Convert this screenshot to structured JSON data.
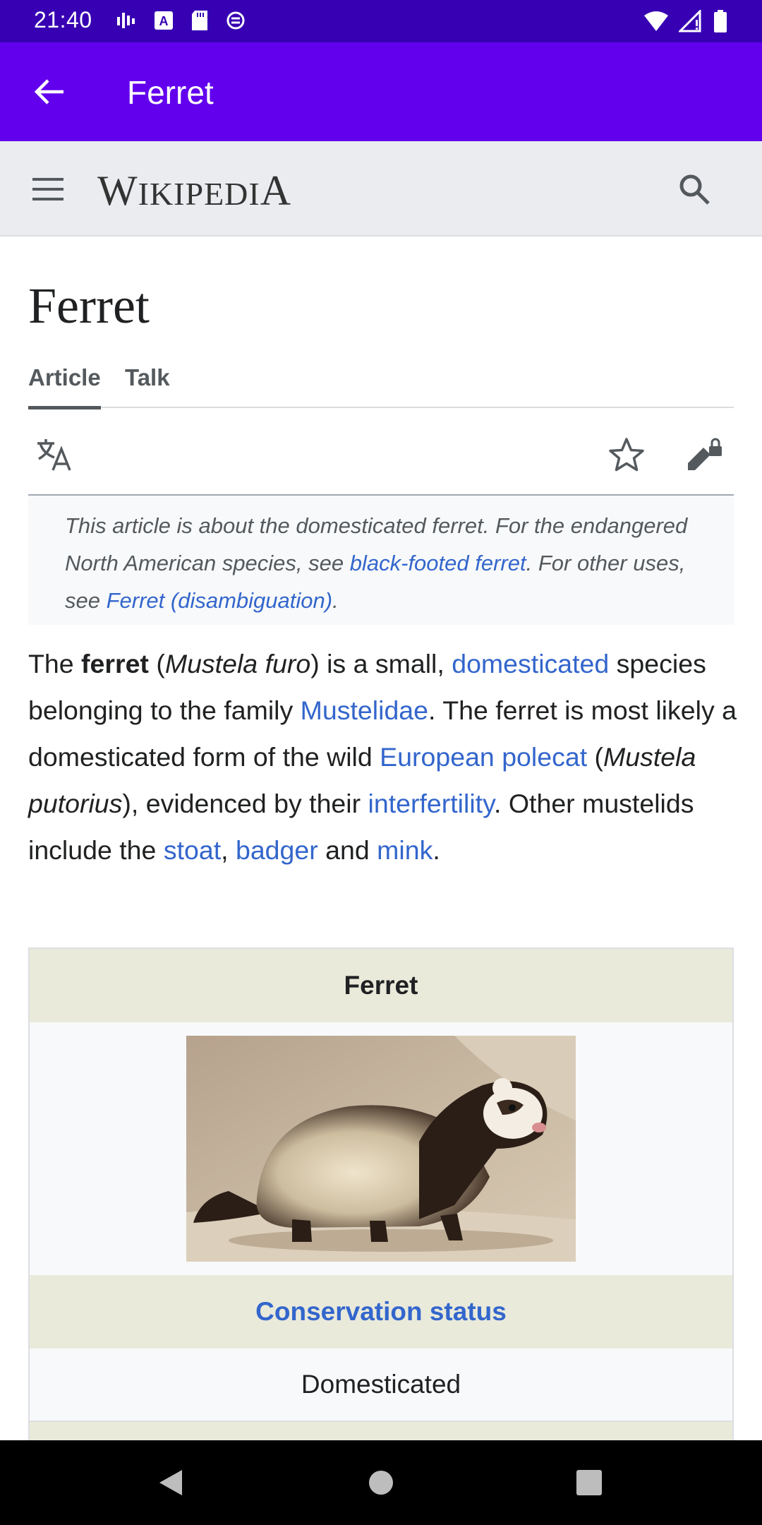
{
  "status_bar": {
    "time": "21:40"
  },
  "app_bar": {
    "title": "Ferret"
  },
  "wiki_header": {
    "wordmark_first": "W",
    "wordmark_rest": "IKIPEDI",
    "wordmark_last": "A"
  },
  "article": {
    "title": "Ferret",
    "tabs": [
      {
        "label": "Article",
        "selected": true
      },
      {
        "label": "Talk",
        "selected": false
      }
    ],
    "hatnote": {
      "text_1": "This article is about the domesticated ferret. For the endangered North American species, see ",
      "link_1": "black-footed ferret",
      "text_2": ". For other uses, see ",
      "link_2": "Ferret (disambiguation)",
      "text_3": "."
    },
    "lead": {
      "t1": "The ",
      "b1": "ferret",
      "t2": " (",
      "i1": "Mustela furo",
      "t3": ") is a small, ",
      "l1": "domesticated",
      "t4": " species belonging to the family ",
      "l2": "Mustelidae",
      "t5": ". The ferret is most likely a domesticated form of the wild ",
      "l3": "European polecat",
      "t6": " (",
      "i2": "Mustela putorius",
      "t7": "), evidenced by their ",
      "l4": "interfertility",
      "t8": ". Other mustelids include the ",
      "l5": "stoat",
      "t9": ", ",
      "l6": "badger",
      "t10": " and ",
      "l7": "mink",
      "t11": "."
    },
    "infobox": {
      "caption": "Ferret",
      "conservation_label": "Conservation status",
      "conservation_value": "Domesticated"
    }
  },
  "colors": {
    "status_bar": "#3700b3",
    "app_bar": "#6200ee",
    "link": "#3366cc",
    "infobox_header": "#eaeadb"
  },
  "icons": [
    "back-arrow-icon",
    "hamburger-menu-icon",
    "search-icon",
    "translate-icon",
    "star-icon",
    "edit-locked-icon"
  ]
}
